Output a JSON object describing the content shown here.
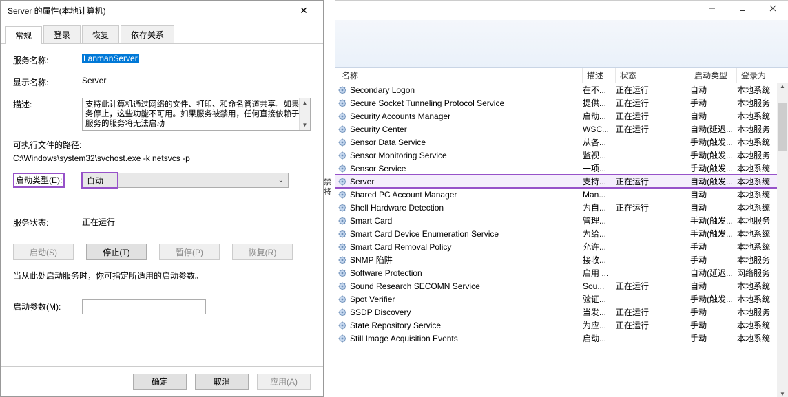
{
  "dialog": {
    "title": "Server 的属性(本地计算机)",
    "tabs": [
      "常规",
      "登录",
      "恢复",
      "依存关系"
    ],
    "activeTab": 0,
    "labels": {
      "serviceName": "服务名称:",
      "displayName": "显示名称:",
      "description": "描述:",
      "exePath": "可执行文件的路径:",
      "startupType": "启动类型(E):",
      "serviceStatus": "服务状态:",
      "startParamNote": "当从此处启动服务时，你可指定所适用的启动参数。",
      "startParams": "启动参数(M):"
    },
    "values": {
      "serviceName": "LanmanServer",
      "displayName": "Server",
      "description": "支持此计算机通过网络的文件、打印、和命名管道共享。如果服务停止，这些功能不可用。如果服务被禁用，任何直接依赖于此服务的服务将无法启动",
      "exePath": "C:\\Windows\\system32\\svchost.exe -k netsvcs -p",
      "startupType": "自动",
      "serviceStatus": "正在运行",
      "startParams": ""
    },
    "buttons": {
      "start": "启动(S)",
      "stop": "停止(T)",
      "pause": "暂停(P)",
      "resume": "恢复(R)",
      "ok": "确定",
      "cancel": "取消",
      "apply": "应用(A)"
    }
  },
  "bgStrip": "禁将",
  "servicesWindow": {
    "columns": {
      "name": "名称",
      "description": "描述",
      "status": "状态",
      "startupType": "启动类型",
      "logonAs": "登录为"
    },
    "selectedIndex": 7,
    "rows": [
      {
        "name": "Secondary Logon",
        "desc": "在不...",
        "status": "正在运行",
        "start": "自动",
        "logon": "本地系统"
      },
      {
        "name": "Secure Socket Tunneling Protocol Service",
        "desc": "提供...",
        "status": "正在运行",
        "start": "手动",
        "logon": "本地服务"
      },
      {
        "name": "Security Accounts Manager",
        "desc": "启动...",
        "status": "正在运行",
        "start": "自动",
        "logon": "本地系统"
      },
      {
        "name": "Security Center",
        "desc": "WSC...",
        "status": "正在运行",
        "start": "自动(延迟...",
        "logon": "本地服务"
      },
      {
        "name": "Sensor Data Service",
        "desc": "从各...",
        "status": "",
        "start": "手动(触发...",
        "logon": "本地系统"
      },
      {
        "name": "Sensor Monitoring Service",
        "desc": "监视...",
        "status": "",
        "start": "手动(触发...",
        "logon": "本地服务"
      },
      {
        "name": "Sensor Service",
        "desc": "一项...",
        "status": "",
        "start": "手动(触发...",
        "logon": "本地系统"
      },
      {
        "name": "Server",
        "desc": "支持...",
        "status": "正在运行",
        "start": "自动(触发...",
        "logon": "本地系统"
      },
      {
        "name": "Shared PC Account Manager",
        "desc": "Man...",
        "status": "",
        "start": "自动",
        "logon": "本地系统"
      },
      {
        "name": "Shell Hardware Detection",
        "desc": "为自...",
        "status": "正在运行",
        "start": "自动",
        "logon": "本地系统"
      },
      {
        "name": "Smart Card",
        "desc": "管理...",
        "status": "",
        "start": "手动(触发...",
        "logon": "本地服务"
      },
      {
        "name": "Smart Card Device Enumeration Service",
        "desc": "为给...",
        "status": "",
        "start": "手动(触发...",
        "logon": "本地系统"
      },
      {
        "name": "Smart Card Removal Policy",
        "desc": "允许...",
        "status": "",
        "start": "手动",
        "logon": "本地系统"
      },
      {
        "name": "SNMP 陷阱",
        "desc": "接收...",
        "status": "",
        "start": "手动",
        "logon": "本地服务"
      },
      {
        "name": "Software Protection",
        "desc": "启用 ...",
        "status": "",
        "start": "自动(延迟...",
        "logon": "网络服务"
      },
      {
        "name": "Sound Research SECOMN Service",
        "desc": "Sou...",
        "status": "正在运行",
        "start": "自动",
        "logon": "本地系统"
      },
      {
        "name": "Spot Verifier",
        "desc": "验证...",
        "status": "",
        "start": "手动(触发...",
        "logon": "本地系统"
      },
      {
        "name": "SSDP Discovery",
        "desc": "当发...",
        "status": "正在运行",
        "start": "手动",
        "logon": "本地服务"
      },
      {
        "name": "State Repository Service",
        "desc": "为应...",
        "status": "正在运行",
        "start": "手动",
        "logon": "本地系统"
      },
      {
        "name": "Still Image Acquisition Events",
        "desc": "启动...",
        "status": "",
        "start": "手动",
        "logon": "本地系统"
      }
    ]
  }
}
